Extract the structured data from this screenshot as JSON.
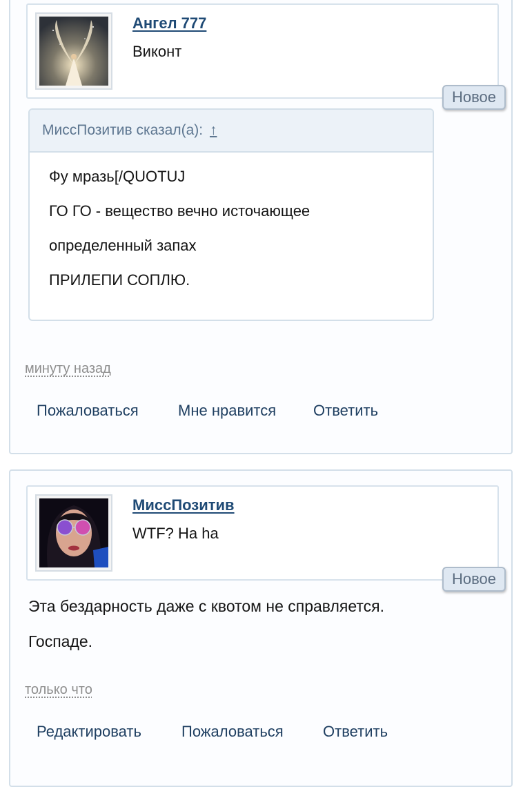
{
  "posts": [
    {
      "username": "Ангел 777",
      "user_title": "Виконт",
      "avatar_icon": "angel-avatar",
      "badge": "Новое",
      "quote": {
        "header": "МиссПозитив сказал(а):",
        "arrow": "↑",
        "lines": [
          "Фу мразь[/QUOTUJ",
          "ГО ГО - вещество вечно источающее",
          "определенный запах",
          "ПРИЛЕПИ СОПЛЮ."
        ]
      },
      "time": "минуту назад",
      "actions": [
        "Пожаловаться",
        "Мне нравится",
        "Ответить"
      ]
    },
    {
      "username": "МиссПозитив",
      "user_title": "WTF? Ha ha",
      "avatar_icon": "woman-sunglasses-avatar",
      "badge": "Новое",
      "body": [
        "Эта бездарность даже с квотом не справляется.",
        "Госпаде."
      ],
      "time": "только что",
      "actions": [
        "Редактировать",
        "Пожаловаться",
        "Ответить"
      ]
    }
  ],
  "colors": {
    "link": "#1f4a75",
    "border": "#d3dfe9",
    "badge_bg": "#dfe8f2",
    "quote_header_bg": "#ecf2f8"
  }
}
